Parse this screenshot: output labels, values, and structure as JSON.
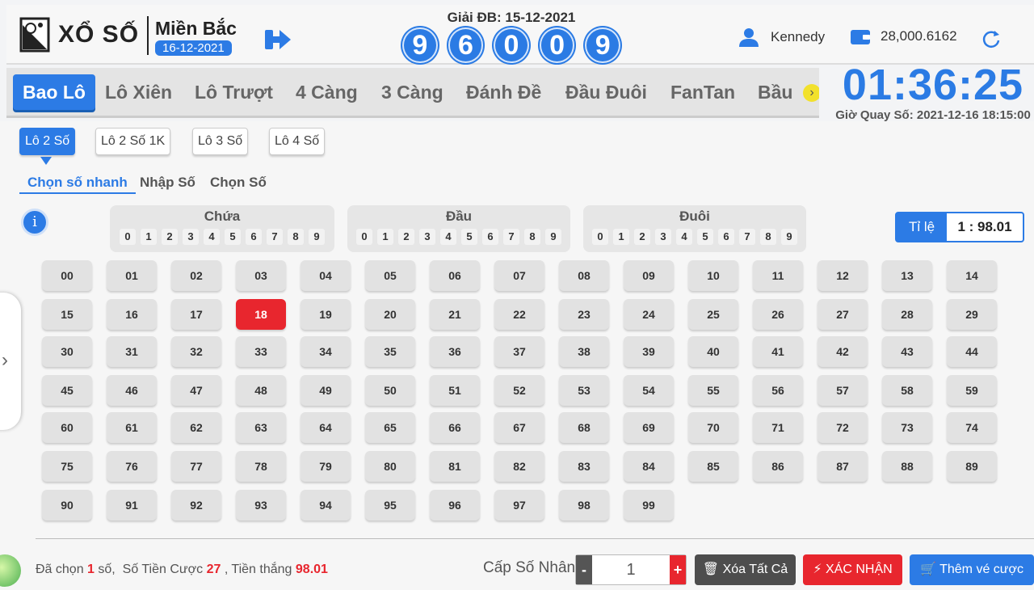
{
  "header": {
    "logo_text": "XỔ SỐ",
    "region_name": "Miền Bắc",
    "region_date": "16-12-2021",
    "special_label": "Giải ĐB: 15-12-2021",
    "special_digits": [
      "9",
      "6",
      "0",
      "0",
      "9"
    ],
    "username": "Kennedy",
    "balance": "28,000.6162"
  },
  "tabs": [
    {
      "label": "Bao Lô",
      "active": true
    },
    {
      "label": "Lô Xiên",
      "active": false
    },
    {
      "label": "Lô Trượt",
      "active": false
    },
    {
      "label": "4 Càng",
      "active": false
    },
    {
      "label": "3 Càng",
      "active": false
    },
    {
      "label": "Đánh Đề",
      "active": false
    },
    {
      "label": "Đầu Đuôi",
      "active": false
    },
    {
      "label": "FanTan",
      "active": false
    },
    {
      "label": "Bầu",
      "active": false
    }
  ],
  "timer": {
    "value": "01:36:25",
    "label": "Giờ Quay Số: 2021-12-16 18:15:00"
  },
  "subtabs": [
    {
      "label": "Lô 2 Số",
      "active": true
    },
    {
      "label": "Lô 2 Số 1K",
      "active": false
    },
    {
      "label": "Lô 3 Số",
      "active": false
    },
    {
      "label": "Lô 4 Số",
      "active": false
    }
  ],
  "modes": [
    {
      "label": "Chọn số nhanh",
      "active": true
    },
    {
      "label": "Nhập Số",
      "active": false
    },
    {
      "label": "Chọn Số",
      "active": false
    }
  ],
  "filter_groups": [
    {
      "title": "Chứa",
      "digits": [
        "0",
        "1",
        "2",
        "3",
        "4",
        "5",
        "6",
        "7",
        "8",
        "9"
      ]
    },
    {
      "title": "Đầu",
      "digits": [
        "0",
        "1",
        "2",
        "3",
        "4",
        "5",
        "6",
        "7",
        "8",
        "9"
      ]
    },
    {
      "title": "Đuôi",
      "digits": [
        "0",
        "1",
        "2",
        "3",
        "4",
        "5",
        "6",
        "7",
        "8",
        "9"
      ]
    }
  ],
  "ratio": {
    "label": "Tỉ lệ",
    "value": "1 : 98.01"
  },
  "numbers": {
    "selected": [
      "18"
    ]
  },
  "summary": {
    "prefix": "Đã chọn",
    "count": "1",
    "count_suffix": "số,",
    "bet_label": "Số Tiền Cược",
    "bet_value": "27",
    "win_label": ", Tiền thắng",
    "win_value": "98.01"
  },
  "multiplier": {
    "label": "Cấp Số Nhân",
    "value": "1",
    "minus": "-",
    "plus": "+"
  },
  "actions": {
    "clear_label": "Xóa Tất Cả",
    "confirm_label": "XÁC NHẬN",
    "add_label": "Thêm vé cược"
  },
  "colors": {
    "accent": "#2c7be5",
    "danger": "#e8262e",
    "dark": "#4d4d4d"
  }
}
